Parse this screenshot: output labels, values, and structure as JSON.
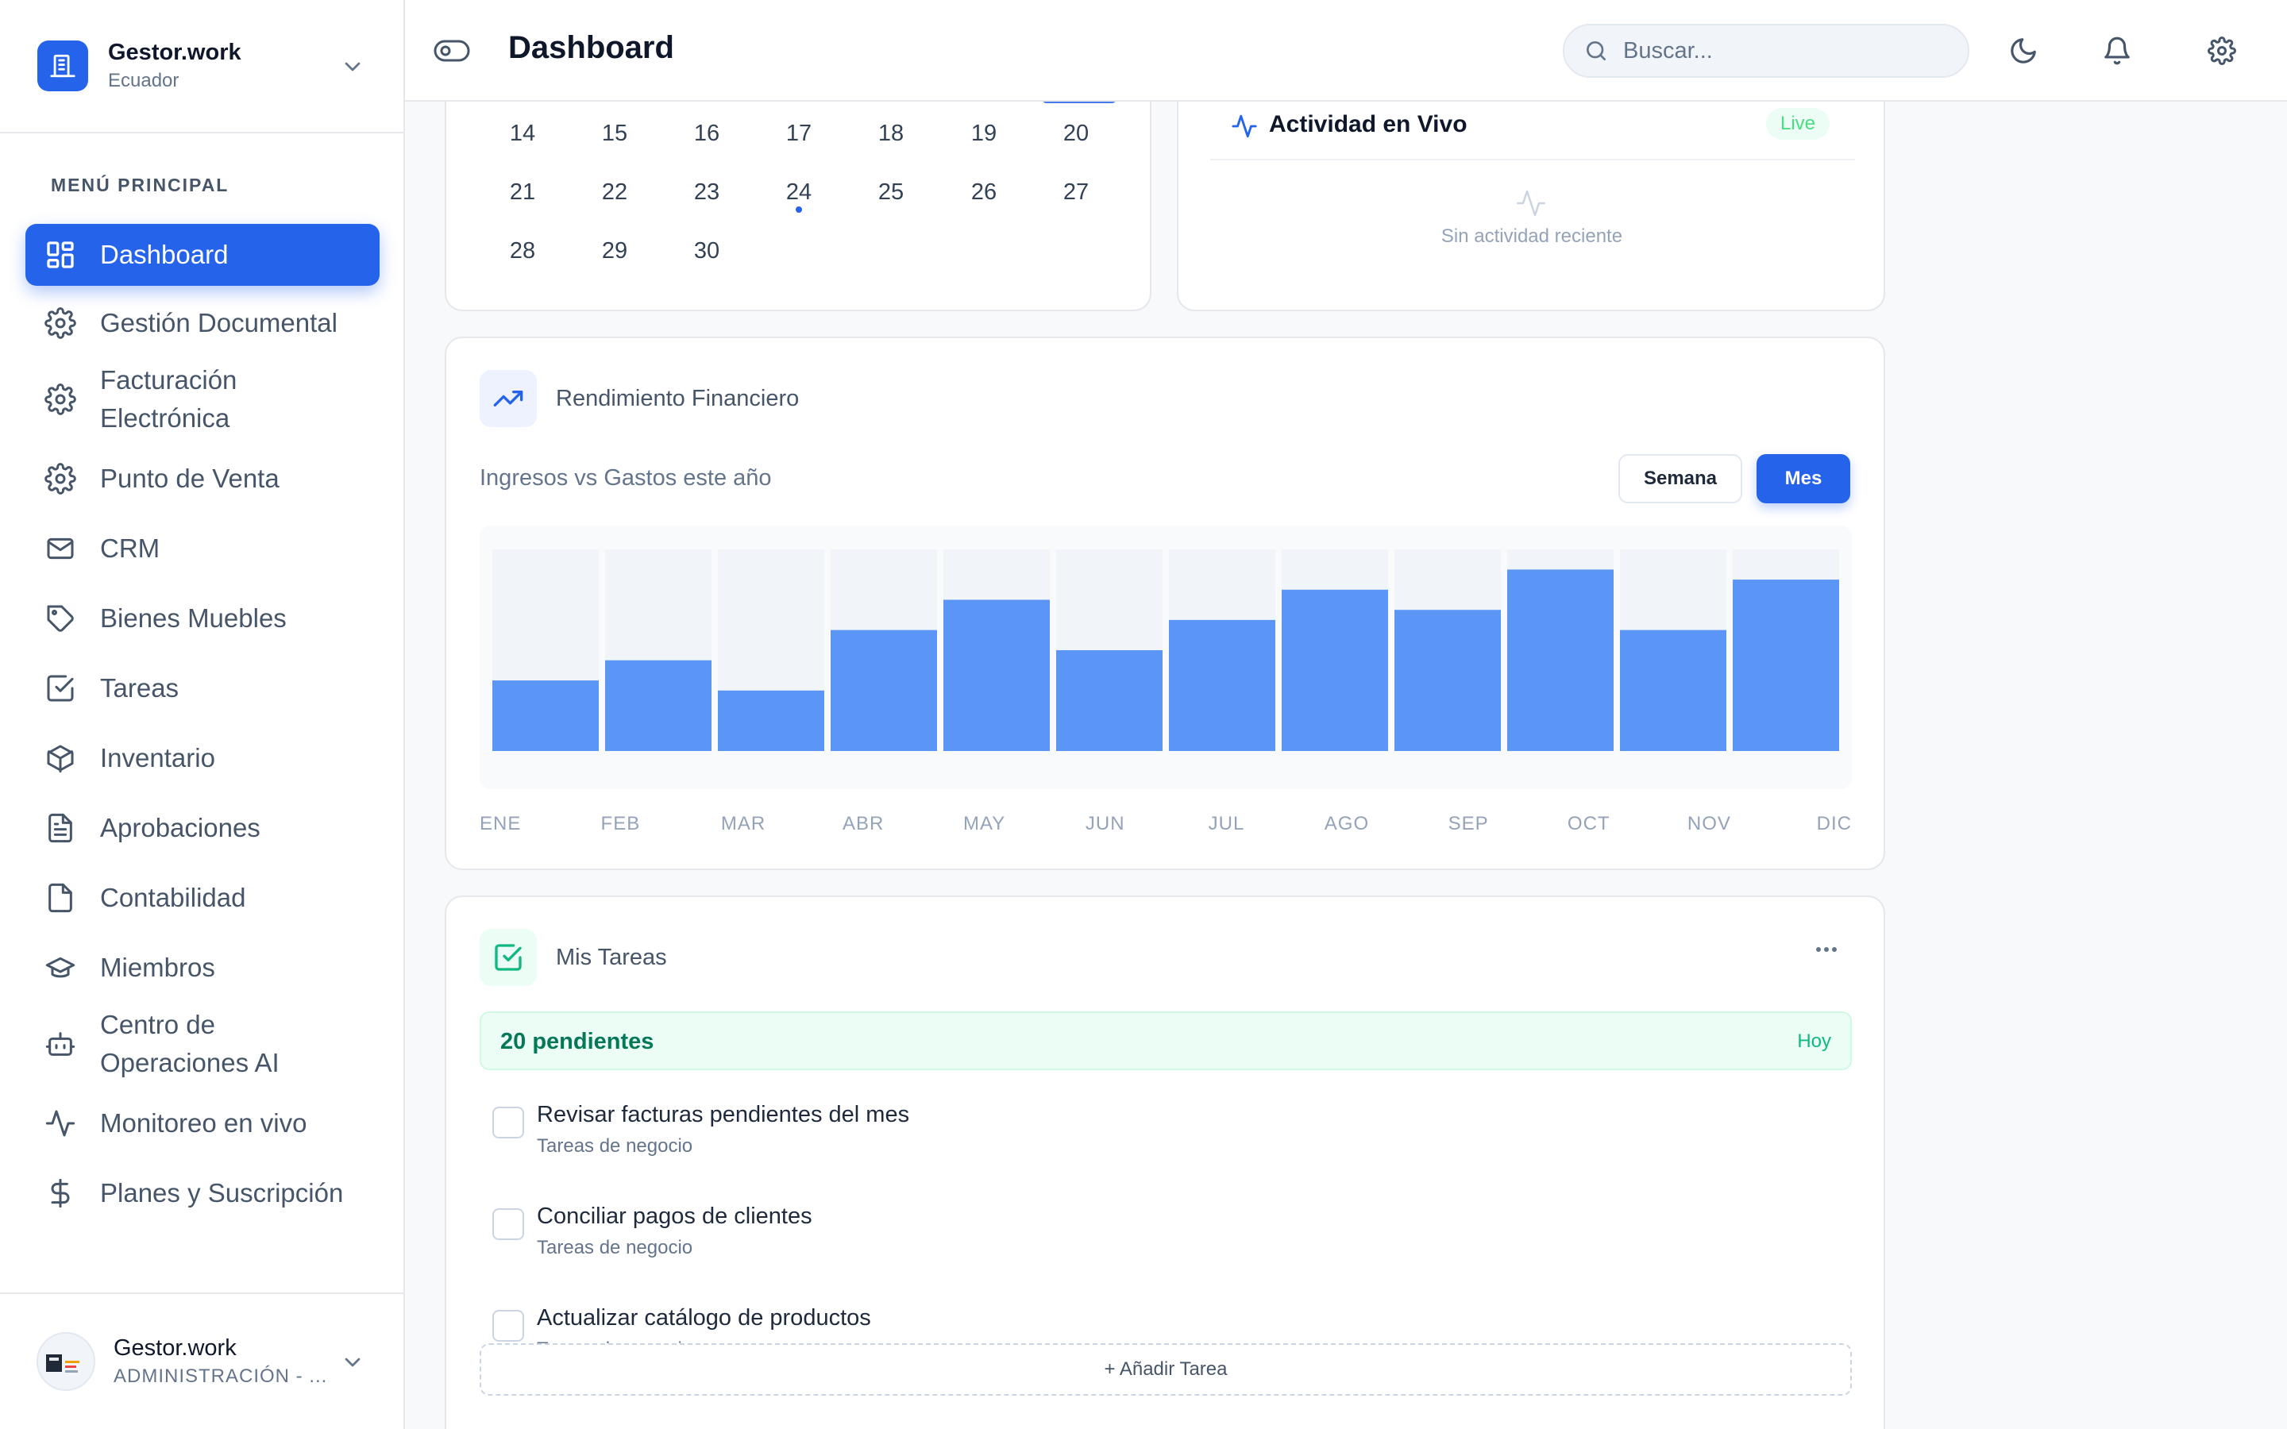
{
  "brand": {
    "name": "Gestor.work",
    "subtitle": "Ecuador"
  },
  "sidebar": {
    "menu_title": "MENÚ PRINCIPAL",
    "items": [
      {
        "label": "Dashboard",
        "icon": "grid-icon",
        "active": true
      },
      {
        "label": "Gestión Documental",
        "icon": "gear-icon"
      },
      {
        "label": "Facturación Electrónica",
        "icon": "gear-icon"
      },
      {
        "label": "Punto de Venta",
        "icon": "gear-icon"
      },
      {
        "label": "CRM",
        "icon": "mail-icon"
      },
      {
        "label": "Bienes Muebles",
        "icon": "tag-icon"
      },
      {
        "label": "Tareas",
        "icon": "checkbox-icon"
      },
      {
        "label": "Inventario",
        "icon": "package-icon"
      },
      {
        "label": "Aprobaciones",
        "icon": "document-icon"
      },
      {
        "label": "Contabilidad",
        "icon": "file-icon"
      },
      {
        "label": "Miembros",
        "icon": "graduation-cap-icon"
      },
      {
        "label": "Centro de Operaciones AI",
        "icon": "bot-icon"
      },
      {
        "label": "Monitoreo en vivo",
        "icon": "activity-icon"
      },
      {
        "label": "Planes y Suscripción",
        "icon": "dollar-icon"
      }
    ]
  },
  "user": {
    "name": "Gestor.work",
    "role": "ADMINISTRACIÓN - ..."
  },
  "header": {
    "title": "Dashboard",
    "search_placeholder": "Buscar..."
  },
  "calendar": {
    "weeks": [
      [
        "14",
        "15",
        "16",
        "17",
        "18",
        "19",
        "20"
      ],
      [
        "21",
        "22",
        "23",
        "24",
        "25",
        "26",
        "27"
      ],
      [
        "28",
        "29",
        "30"
      ]
    ],
    "today": "24"
  },
  "live": {
    "title": "Actividad en Vivo",
    "badge": "Live",
    "empty": "Sin actividad reciente"
  },
  "finance": {
    "title": "Rendimiento Financiero",
    "subtitle": "Ingresos vs Gastos este año",
    "tabs": {
      "week": "Semana",
      "month": "Mes"
    },
    "active_tab": "Mes"
  },
  "chart_data": {
    "type": "bar",
    "categories": [
      "ENE",
      "FEB",
      "MAR",
      "ABR",
      "MAY",
      "JUN",
      "JUL",
      "AGO",
      "SEP",
      "OCT",
      "NOV",
      "DIC"
    ],
    "values": [
      35,
      45,
      30,
      60,
      75,
      50,
      65,
      80,
      70,
      90,
      60,
      85
    ],
    "ylim": [
      0,
      100
    ],
    "colors": {
      "bar": "#5b95f5",
      "track": "#f1f5f9"
    },
    "grid": false,
    "legend": false
  },
  "tasks": {
    "title": "Mis Tareas",
    "pending": "20 pendientes",
    "today": "Hoy",
    "items": [
      {
        "name": "Revisar facturas pendientes del mes",
        "category": "Tareas de negocio"
      },
      {
        "name": "Conciliar pagos de clientes",
        "category": "Tareas de negocio"
      },
      {
        "name": "Actualizar catálogo de productos",
        "category": "Tareas de negocio"
      }
    ],
    "add_label": "+ Añadir Tarea"
  },
  "colors": {
    "accent": "#2563eb",
    "success": "#10b981"
  }
}
